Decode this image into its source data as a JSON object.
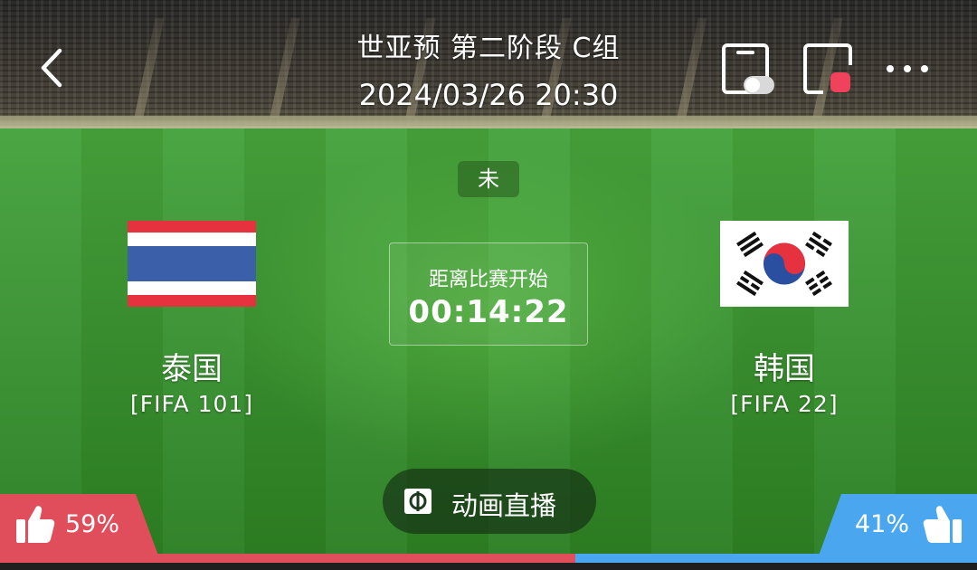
{
  "header": {
    "title": "世亚预 第二阶段 C组",
    "datetime": "2024/03/26 20:30",
    "icons": [
      "back-icon",
      "small-window-icon",
      "record-icon",
      "more-icon"
    ]
  },
  "match": {
    "status": "未",
    "countdown_label": "距离比赛开始",
    "countdown_time": "00:14:22"
  },
  "home_team": {
    "name": "泰国",
    "rank": "[FIFA 101]",
    "flag": "thailand-flag-icon"
  },
  "away_team": {
    "name": "韩国",
    "rank": "[FIFA 22]",
    "flag": "south-korea-flag-icon"
  },
  "live_button": {
    "label": "动画直播",
    "icon": "animation-live-icon"
  },
  "votes": {
    "home_percent": "59%",
    "away_percent": "41%",
    "home_color": "#e04d5b",
    "away_color": "#4aa6ee"
  }
}
